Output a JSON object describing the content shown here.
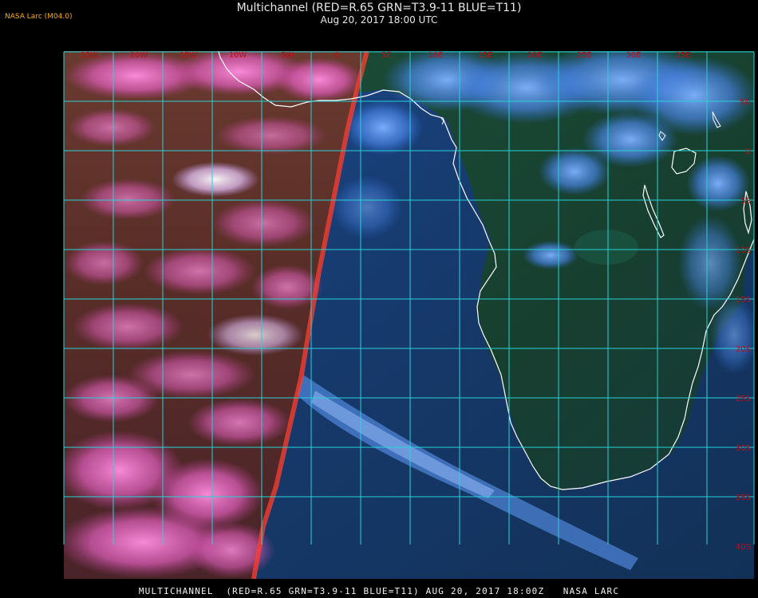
{
  "header": {
    "credit": "NASA Larc (M04.0)",
    "title": "Multichannel (RED=R.65 GRN=T3.9-11 BLUE=T11)",
    "subtitle": "Aug 20, 2017 18:00 UTC"
  },
  "footer": {
    "caption": "MULTICHANNEL  (RED=R.65 GRN=T3.9-11 BLUE=T11) AUG 20, 2017 18:00Z   NASA LARC"
  },
  "map": {
    "longitude_labels": [
      "25W",
      "20W",
      "15W",
      "10W",
      "5W",
      "0",
      "5E",
      "10E",
      "15E",
      "20E",
      "25E",
      "30E",
      "35E"
    ],
    "latitude_labels": [
      "5N",
      "0",
      "5S",
      "10S",
      "15S",
      "20S",
      "25S",
      "30S",
      "35S",
      "40S"
    ],
    "colors": {
      "grid": "#27d3d8",
      "label": "#c80a14",
      "coastline": "#ffffff",
      "ocean_night": "#16355f",
      "land_night": "#173f2f",
      "cloud_night": "#3c7ee8",
      "day_side": "#7a2d2a",
      "day_cloud": "#f06ed0",
      "terminator": "#ff3e2e"
    }
  }
}
